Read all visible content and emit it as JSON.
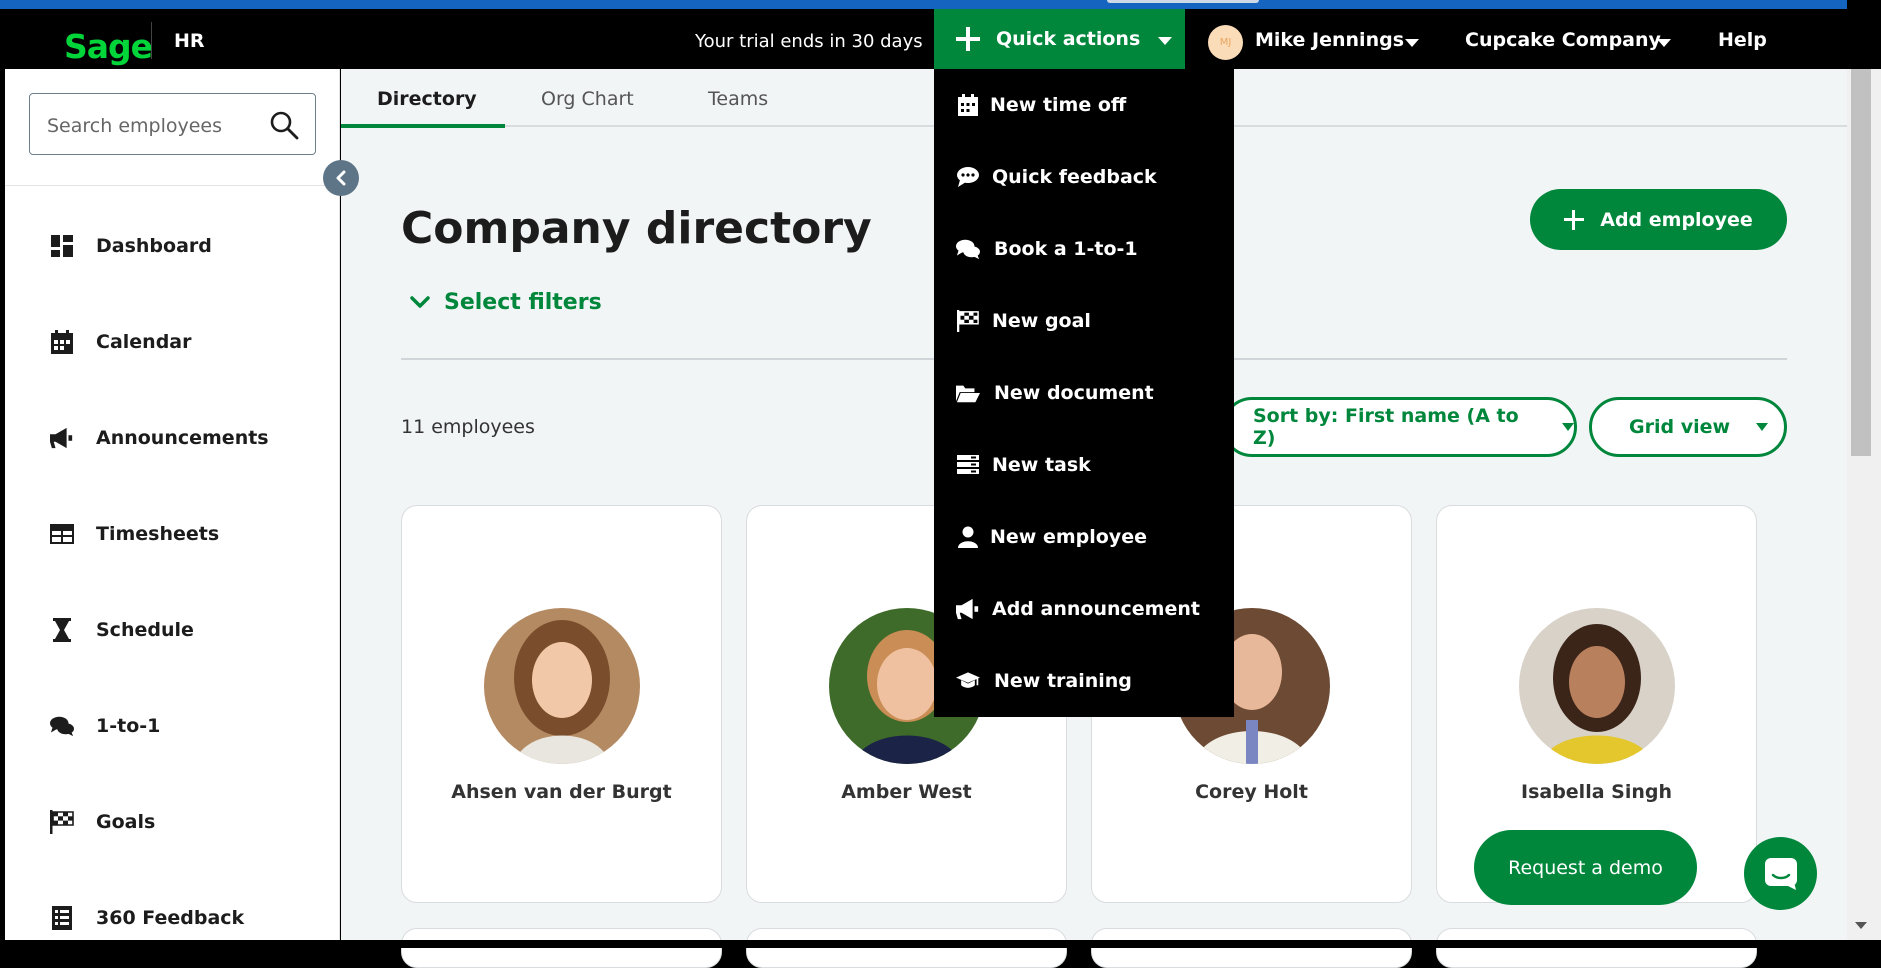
{
  "topbar": {
    "logo": "Sage",
    "app_name": "HR",
    "trial_text": "Your trial ends in 30 days",
    "quick_actions_label": "Quick actions",
    "avatar_initials": "MJ",
    "user_name": "Mike Jennings",
    "company_name": "Cupcake Company",
    "help_label": "Help"
  },
  "sidebar": {
    "search_placeholder": "Search employees",
    "items": [
      {
        "label": "Dashboard",
        "icon": "dashboard-icon"
      },
      {
        "label": "Calendar",
        "icon": "calendar-icon"
      },
      {
        "label": "Announcements",
        "icon": "megaphone-icon"
      },
      {
        "label": "Timesheets",
        "icon": "table-icon"
      },
      {
        "label": "Schedule",
        "icon": "hourglass-icon"
      },
      {
        "label": "1-to-1",
        "icon": "chat-bubbles-icon"
      },
      {
        "label": "Goals",
        "icon": "checkered-flag-icon"
      },
      {
        "label": "360 Feedback",
        "icon": "checklist-icon"
      }
    ]
  },
  "tabs": [
    {
      "label": "Directory",
      "active": true
    },
    {
      "label": "Org Chart",
      "active": false
    },
    {
      "label": "Teams",
      "active": false
    }
  ],
  "main": {
    "title": "Company directory",
    "filters_label": "Select filters",
    "add_employee_label": "Add employee",
    "employee_count": "11 employees",
    "sort_label": "Sort by: First name (A to Z)",
    "view_label": "Grid view",
    "employees": [
      {
        "name": "Ahsen van der Burgt"
      },
      {
        "name": "Amber West"
      },
      {
        "name": "Corey Holt"
      },
      {
        "name": "Isabella Singh"
      }
    ],
    "request_demo_label": "Request a demo"
  },
  "quick_actions_menu": [
    {
      "label": "New time off",
      "icon": "calendar-icon"
    },
    {
      "label": "Quick feedback",
      "icon": "speech-bubble-icon"
    },
    {
      "label": "Book a 1-to-1",
      "icon": "chat-bubbles-icon"
    },
    {
      "label": "New goal",
      "icon": "checkered-flag-icon"
    },
    {
      "label": "New document",
      "icon": "folder-open-icon"
    },
    {
      "label": "New task",
      "icon": "task-list-icon"
    },
    {
      "label": "New employee",
      "icon": "person-icon"
    },
    {
      "label": "Add announcement",
      "icon": "megaphone-icon"
    },
    {
      "label": "New training",
      "icon": "graduation-cap-icon"
    }
  ],
  "colors": {
    "brand_green": "#00873c",
    "logo_green": "#00d639",
    "top_strip_blue": "#1565c0",
    "content_bg": "#f2f5f6"
  }
}
